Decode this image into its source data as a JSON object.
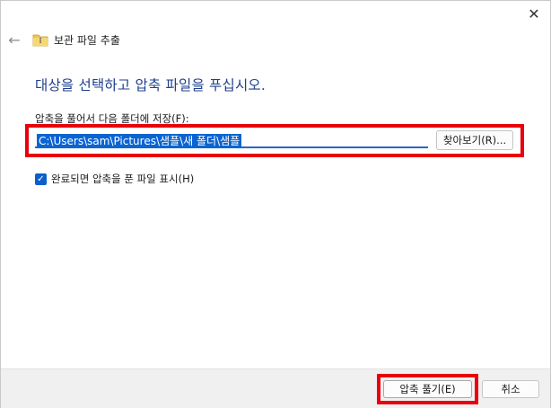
{
  "window": {
    "title": "보관 파일 추출",
    "close_glyph": "✕",
    "back_glyph": "←",
    "folder_icon": "zip-folder-icon"
  },
  "main": {
    "heading": "대상을 선택하고 압축 파일을 푸십시오.",
    "destination_label": "압축을 풀어서 다음 폴더에 저장(F):",
    "destination_path": "C:\\Users\\sam\\Pictures\\샘플\\새 폴더\\샘플",
    "browse_label": "찾아보기(R)...",
    "show_files_label": "완료되면 압축을 푼 파일 표시(H)",
    "show_files_checked": true,
    "checkmark_glyph": "✓"
  },
  "footer": {
    "extract_label": "압축 풀기(E)",
    "cancel_label": "취소"
  },
  "colors": {
    "heading": "#1e3f8c",
    "selection": "#0a64d2",
    "checkbox": "#0a5fcc",
    "highlight": "#e8000b"
  }
}
